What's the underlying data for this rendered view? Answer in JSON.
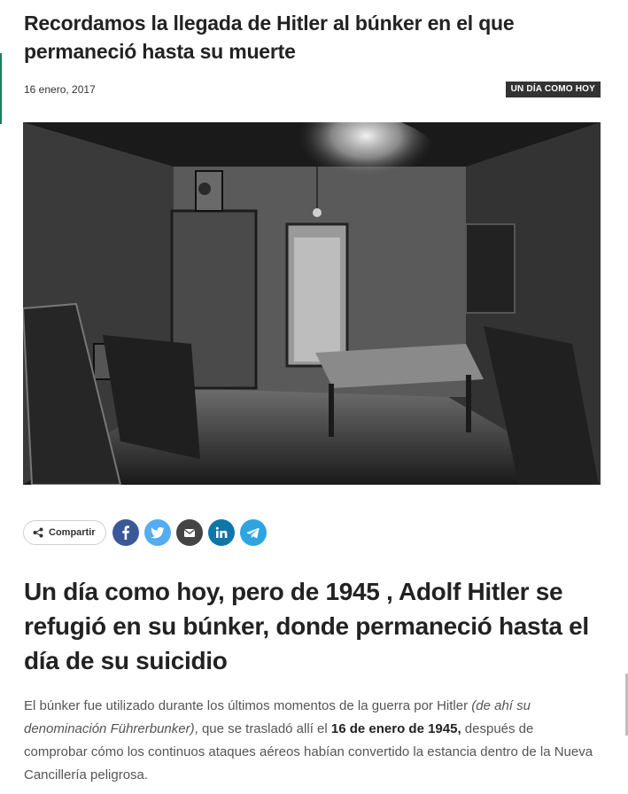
{
  "article": {
    "title": "Recordamos la llegada de Hitler al búnker en el que permaneció hasta su muerte",
    "date": "16 enero, 2017",
    "category": "UN DÍA COMO HOY",
    "subtitle": "Un día como hoy, pero de 1945 , Adolf Hitler se refugió en su búnker, donde permaneció hasta el día de su suicidio",
    "body": {
      "p1": "El búnker fue utilizado durante los últimos momentos de la guerra por Hitler ",
      "p1_italic": "(de ahí su denominación Führerbunker)",
      "p1_mid": ", que se trasladó allí el ",
      "p1_bold": "16 de enero de 1945,",
      "p1_end": " después de comprobar cómo los continuos ataques aéreos habían convertido la estancia dentro de la Nueva Cancillería peligrosa."
    }
  },
  "share": {
    "label": "Compartir",
    "buttons": [
      {
        "name": "facebook",
        "icon": "facebook-icon",
        "color": "#3b5998"
      },
      {
        "name": "twitter",
        "icon": "twitter-icon",
        "color": "#55acee"
      },
      {
        "name": "email",
        "icon": "envelope-icon",
        "color": "#444444"
      },
      {
        "name": "linkedin",
        "icon": "linkedin-icon",
        "color": "#0e76a8"
      },
      {
        "name": "telegram",
        "icon": "telegram-icon",
        "color": "#2ca5e0"
      }
    ]
  },
  "colors": {
    "accent": "#1f7a5a",
    "badge_bg": "#333333"
  }
}
